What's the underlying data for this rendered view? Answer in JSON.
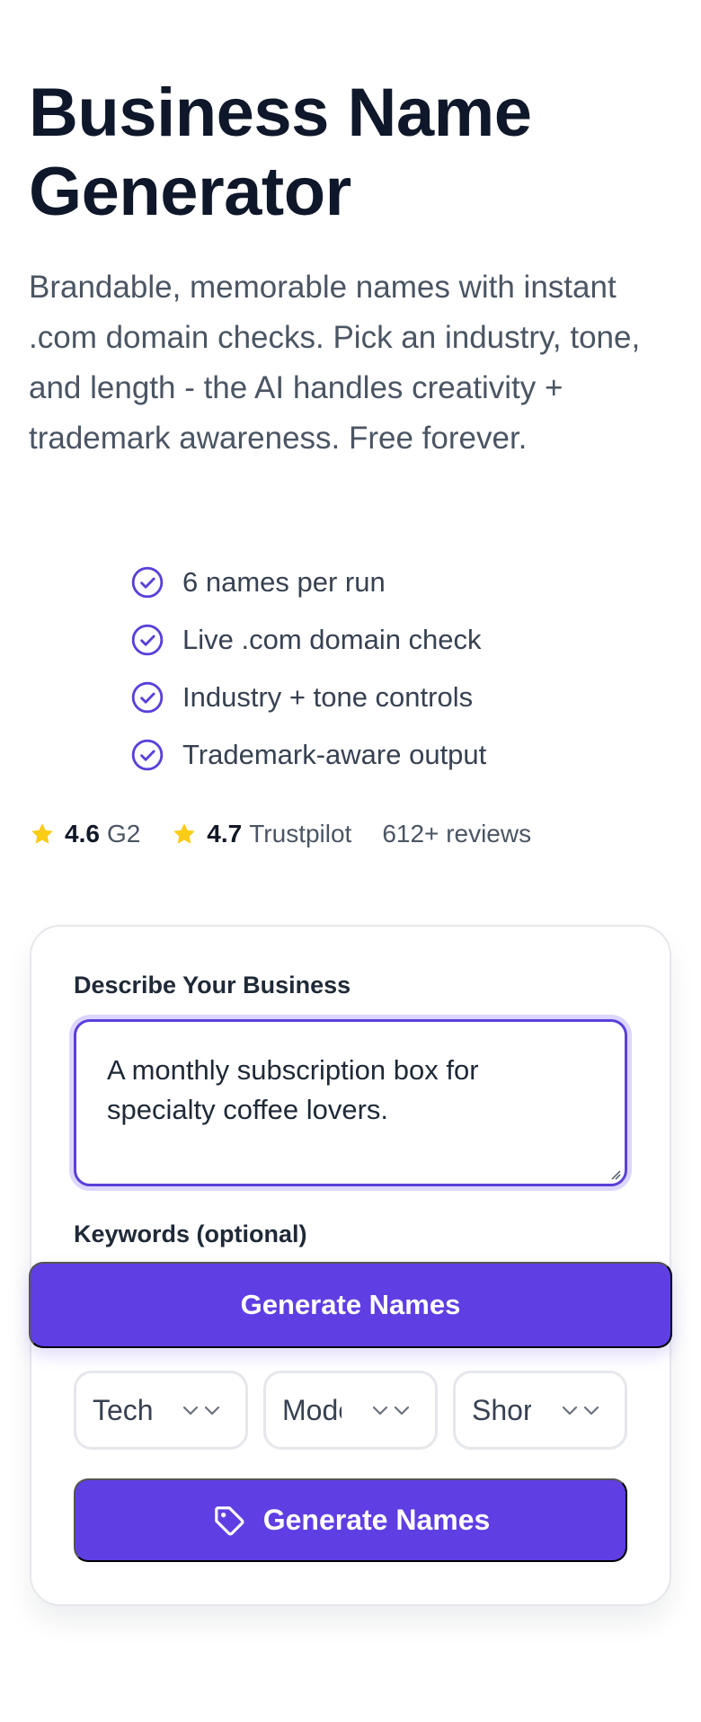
{
  "hero": {
    "title": "Business Name Generator",
    "description": "Brandable, memorable names with instant .com domain checks. Pick an industry, tone, and length - the AI handles creativity + trademark awareness. Free forever."
  },
  "features": [
    "6 names per run",
    "Live .com domain check",
    "Industry + tone controls",
    "Trademark-aware output"
  ],
  "ratings": {
    "g2": {
      "score": "4.6",
      "source": "G2"
    },
    "trustpilot": {
      "score": "4.7",
      "source": "Trustpilot"
    },
    "reviews": "612+ reviews"
  },
  "form": {
    "description_label": "Describe Your Business",
    "description_value": "A monthly subscription box for specialty coffee lovers.",
    "keywords_label": "Keywords (optional)",
    "overlay_button_label": "Generate Names",
    "selects": {
      "industry": "Tech",
      "tone": "Modern",
      "length": "Short"
    },
    "generate_button_label": "Generate Names"
  },
  "icons": {
    "check": "check-circle-icon",
    "star": "star-icon",
    "chevron": "chevron-down-icon",
    "tag": "tag-icon"
  },
  "colors": {
    "accent": "#5f3ee3",
    "star": "#facc15",
    "title": "#0f172a"
  }
}
